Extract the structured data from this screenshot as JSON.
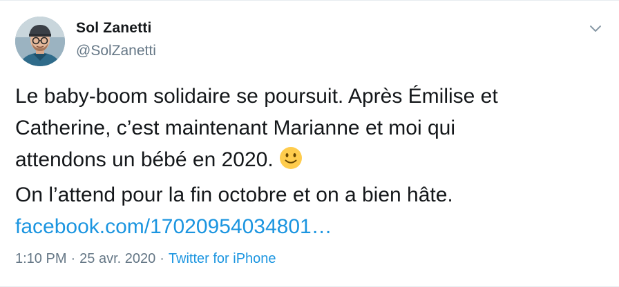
{
  "author": {
    "display_name": "Sol Zanetti",
    "handle": "@SolZanetti",
    "avatar_icon": "profile-photo"
  },
  "menu_icon": "chevron-down-icon",
  "tweet": {
    "lines": [
      "Le baby-boom solidaire se poursuit. Après Émilise et",
      "Catherine, c’est maintenant Marianne et moi qui",
      "attendons un bébé en 2020.",
      "On l’attend pour la fin octobre et on a bien hâte."
    ],
    "emoji": "slightly-smiling-face",
    "link_text": "facebook.com/17020954034801…"
  },
  "meta": {
    "time": "1:10 PM",
    "separator_1": "·",
    "date": "25 avr. 2020",
    "separator_2": "·",
    "source": "Twitter for iPhone"
  },
  "colors": {
    "text": "#14171a",
    "secondary": "#657786",
    "link": "#1b95e0",
    "emoji": "#ffcc4d"
  }
}
